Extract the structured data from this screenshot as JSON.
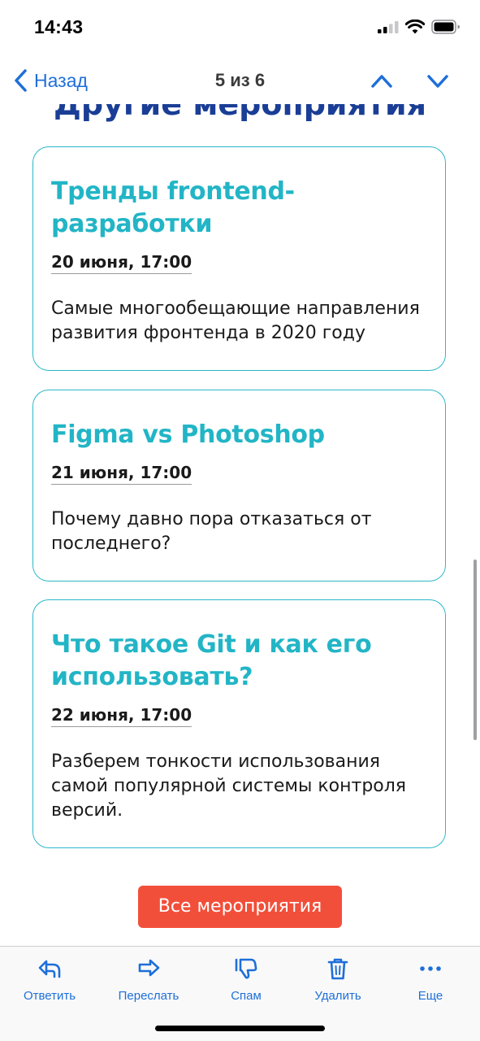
{
  "status_bar": {
    "time": "14:43",
    "icons": [
      "cellular-signal-icon",
      "wifi-icon",
      "battery-icon"
    ]
  },
  "nav": {
    "back_label": "Назад",
    "counter": "5 из 6",
    "icons": [
      "chevron-left-icon",
      "chevron-up-icon",
      "chevron-down-icon"
    ]
  },
  "content": {
    "section_heading": "Другие мероприятия",
    "events": [
      {
        "title": "Тренды frontend-разработки",
        "date": "20 июня, 17:00",
        "description": "Самые многообещающие направления развития фронтенда в 2020 году"
      },
      {
        "title": "Figma vs Photoshop",
        "date": "21 июня, 17:00",
        "description": "Почему давно пора отказаться от последнего?"
      },
      {
        "title": "Что такое Git и как его использовать?",
        "date": "22 июня, 17:00",
        "description": "Разберем тонкости использования самой популярной системы контроля версий."
      }
    ],
    "all_events_button": "Все мероприятия"
  },
  "toolbar": {
    "reply": "Ответить",
    "forward": "Переслать",
    "spam": "Спам",
    "delete": "Удалить",
    "more": "Еще"
  },
  "colors": {
    "accent_blue": "#1e6fd9",
    "heading_navy": "#1a3e96",
    "card_teal": "#22b5c6",
    "button_red": "#f24f3a"
  }
}
